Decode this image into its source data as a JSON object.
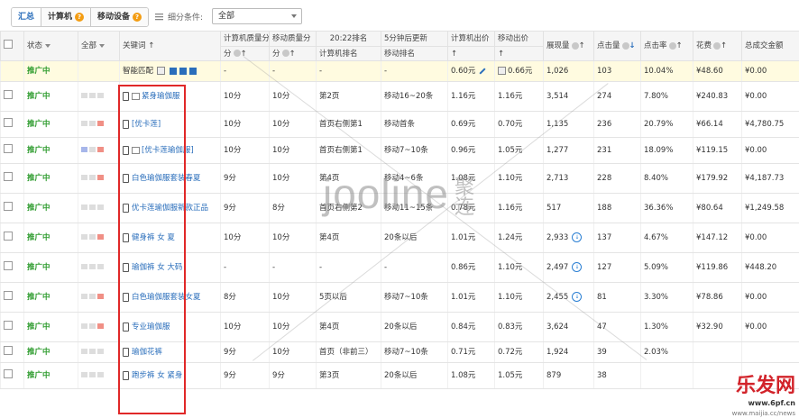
{
  "tabs": [
    {
      "label": "汇总",
      "active": true
    },
    {
      "label": "计算机",
      "has_help": true
    },
    {
      "label": "移动设备",
      "has_help": true
    }
  ],
  "filter": {
    "label": "细分条件:",
    "select_value": "全部"
  },
  "headers": {
    "status": "状态",
    "all": "全部",
    "keyword": "关键词",
    "pc_quality": "计算机质量分",
    "mobile_quality": "移动质量分",
    "rank_time": "20:22排名",
    "rank_5min": "5分钟后更新",
    "pc_bid": "计算机出价",
    "mobile_bid": "移动出价",
    "impressions": "展现量",
    "clicks": "点击量",
    "ctr": "点击率",
    "cost": "花费",
    "total_amount": "总成交金额",
    "pc_rank_sub": "计算机排名",
    "mobile_rank_sub": "移动排名"
  },
  "summary": {
    "status": "推广中",
    "keyword": "智能匹配",
    "pc_quality": "-",
    "mobile_quality": "-",
    "pc_rank": "-",
    "mobile_rank": "-",
    "pc_bid": "0.60元",
    "mobile_bid": "0.66元",
    "impressions": "1,026",
    "clicks": "103",
    "ctr": "10.04%",
    "cost": "¥48.60",
    "total": "¥0.00"
  },
  "rows": [
    {
      "status": "推广中",
      "dots": [
        "g",
        "g",
        "g"
      ],
      "keyword": "紧身瑜伽服",
      "pc_icon": true,
      "pcq": "10分",
      "mq": "10分",
      "pcr": "第2页",
      "mr": "移动16~20条",
      "pcb": "1.16元",
      "mb": "1.16元",
      "imp": "3,514",
      "clk": "274",
      "ctr": "7.80%",
      "cost": "¥240.83",
      "total": "¥0.00"
    },
    {
      "status": "推广中",
      "dots": [
        "g",
        "g",
        "r"
      ],
      "keyword": "[优卡莲]",
      "pc_icon": false,
      "pcq": "10分",
      "mq": "10分",
      "pcr": "首页右侧第1",
      "mr": "移动首条",
      "pcb": "0.69元",
      "mb": "0.70元",
      "imp": "1,135",
      "clk": "236",
      "ctr": "20.79%",
      "cost": "¥66.14",
      "total": "¥4,780.75"
    },
    {
      "status": "推广中",
      "dots": [
        "b",
        "g",
        "r"
      ],
      "keyword": "[优卡莲瑜伽服]",
      "pc_icon": true,
      "pcq": "10分",
      "mq": "10分",
      "pcr": "首页右侧第1",
      "mr": "移动7~10条",
      "pcb": "0.96元",
      "mb": "1.05元",
      "imp": "1,277",
      "clk": "231",
      "ctr": "18.09%",
      "cost": "¥119.15",
      "total": "¥0.00"
    },
    {
      "status": "推广中",
      "dots": [
        "g",
        "g",
        "r"
      ],
      "keyword": "白色瑜伽服套装春夏",
      "pc_icon": false,
      "pcq": "9分",
      "mq": "10分",
      "pcr": "第4页",
      "mr": "移动4~6条",
      "pcb": "1.08元",
      "mb": "1.10元",
      "imp": "2,713",
      "clk": "228",
      "ctr": "8.40%",
      "cost": "¥179.92",
      "total": "¥4,187.73"
    },
    {
      "status": "推广中",
      "dots": [
        "g",
        "g",
        "g"
      ],
      "keyword": "优卡莲瑜伽服新款正品",
      "pc_icon": false,
      "pcq": "9分",
      "mq": "8分",
      "pcr": "首页右侧第2",
      "mr": "移动11~15条",
      "pcb": "0.78元",
      "mb": "1.16元",
      "imp": "517",
      "clk": "188",
      "ctr": "36.36%",
      "cost": "¥80.64",
      "total": "¥1,249.58"
    },
    {
      "status": "推广中",
      "dots": [
        "g",
        "g",
        "r"
      ],
      "keyword": "健身裤 女 夏",
      "pc_icon": false,
      "pcq": "10分",
      "mq": "10分",
      "pcr": "第4页",
      "mr": "20条以后",
      "pcb": "1.01元",
      "mb": "1.24元",
      "imp": "2,933",
      "clk": "137",
      "ctr": "4.67%",
      "cost": "¥147.12",
      "total": "¥0.00",
      "dl": true
    },
    {
      "status": "推广中",
      "dots": [
        "g",
        "g",
        "g"
      ],
      "keyword": "瑜伽裤 女 大码",
      "pc_icon": false,
      "pcq": "-",
      "mq": "-",
      "pcr": "-",
      "mr": "-",
      "pcb": "0.86元",
      "mb": "1.10元",
      "imp": "2,497",
      "clk": "127",
      "ctr": "5.09%",
      "cost": "¥119.86",
      "total": "¥448.20",
      "dl": true
    },
    {
      "status": "推广中",
      "dots": [
        "g",
        "g",
        "r"
      ],
      "keyword": "白色瑜伽服套装女夏",
      "pc_icon": false,
      "pcq": "8分",
      "mq": "10分",
      "pcr": "5页以后",
      "mr": "移动7~10条",
      "pcb": "1.01元",
      "mb": "1.10元",
      "imp": "2,455",
      "clk": "81",
      "ctr": "3.30%",
      "cost": "¥78.86",
      "total": "¥0.00",
      "dl": true
    },
    {
      "status": "推广中",
      "dots": [
        "g",
        "g",
        "r"
      ],
      "keyword": "专业瑜伽服",
      "pc_icon": false,
      "pcq": "10分",
      "mq": "10分",
      "pcr": "第4页",
      "mr": "20条以后",
      "pcb": "0.84元",
      "mb": "0.83元",
      "imp": "3,624",
      "clk": "47",
      "ctr": "1.30%",
      "cost": "¥32.90",
      "total": "¥0.00"
    },
    {
      "status": "推广中",
      "dots": [
        "g",
        "g",
        "g"
      ],
      "keyword": "瑜伽花裤",
      "pc_icon": false,
      "pcq": "9分",
      "mq": "10分",
      "pcr": "首页（非前三）",
      "mr": "移动7~10条",
      "pcb": "0.71元",
      "mb": "0.72元",
      "imp": "1,924",
      "clk": "39",
      "ctr": "2.03%",
      "cost": "",
      "total": ""
    },
    {
      "status": "推广中",
      "dots": [
        "g",
        "g",
        "g"
      ],
      "keyword": "跑步裤 女 紧身",
      "pc_icon": false,
      "pcq": "9分",
      "mq": "9分",
      "pcr": "第3页",
      "mr": "20条以后",
      "pcb": "1.08元",
      "mb": "1.05元",
      "imp": "879",
      "clk": "38",
      "ctr": "",
      "cost": "",
      "total": ""
    }
  ],
  "watermark": {
    "brand": "jooline",
    "cn": "聚连"
  },
  "corner": {
    "logo": "乐发网",
    "url": "www.6pf.cn",
    "url2": "www.maijia.cc/news"
  },
  "colors": {
    "status_green": "#2d9b2d",
    "link_blue": "#2a6ebb",
    "highlight_box": "#e02828",
    "summary_bg": "#fffbe0"
  }
}
